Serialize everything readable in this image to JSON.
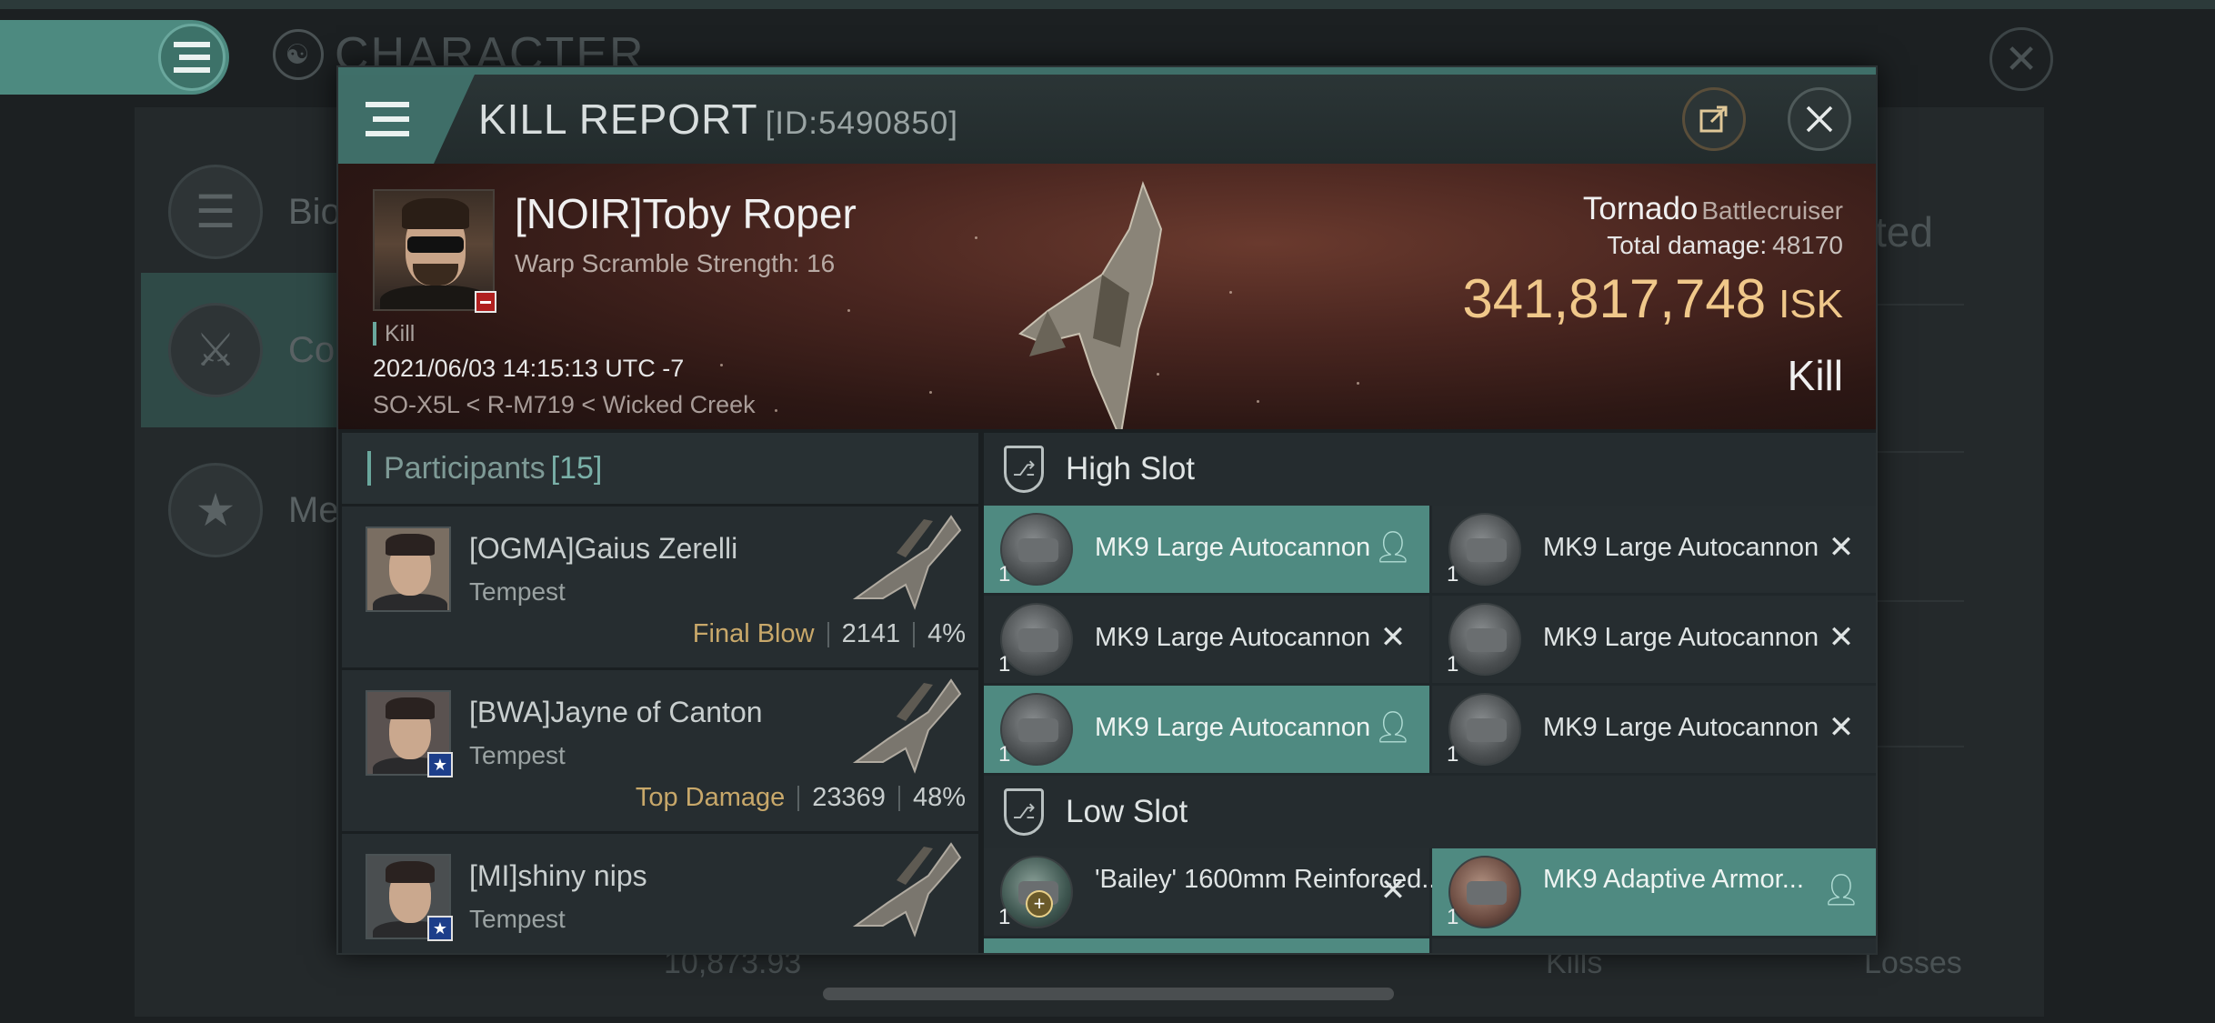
{
  "background": {
    "title": "CHARACTER",
    "side_items": [
      {
        "label": "Bio",
        "icon": "list-icon"
      },
      {
        "label": "Co",
        "icon": "crossed-swords-icon"
      },
      {
        "label": "Me",
        "icon": "star-medal-icon"
      }
    ],
    "right_text": "ted",
    "bottom_value": "10,873.93",
    "bottom_kills": "Kills",
    "bottom_losses": "Losses"
  },
  "modal": {
    "title": "KILL REPORT",
    "id": "[ID:5490850]",
    "share_icon": "share-icon",
    "close_icon": "close-icon"
  },
  "victim": {
    "name": "[NOIR]Toby Roper",
    "subtitle": "Warp Scramble Strength: 16",
    "kill_tag": "Kill",
    "date": "2021/06/03 14:15:13 UTC -7",
    "location": "SO-X5L < R-M719 < Wicked Creek",
    "ship": "Tornado",
    "ship_class": "Battlecruiser",
    "total_damage_label": "Total damage:",
    "total_damage": "48170",
    "isk_value": "341,817,748",
    "isk_unit": "ISK",
    "result": "Kill"
  },
  "participants": {
    "label": "Participants",
    "count": "[15]",
    "rows": [
      {
        "name": "[OGMA]Gaius Zerelli",
        "ship": "Tempest",
        "tag": "Final Blow",
        "damage": "2141",
        "percent": "4%",
        "star": false
      },
      {
        "name": "[BWA]Jayne of Canton",
        "ship": "Tempest",
        "tag": "Top Damage",
        "damage": "23369",
        "percent": "48%",
        "star": true
      },
      {
        "name": "[MI]shiny nips",
        "ship": "Tempest",
        "tag": "",
        "damage": "",
        "percent": "",
        "star": true
      }
    ]
  },
  "fitting": {
    "high_slot_label": "High Slot",
    "low_slot_label": "Low Slot",
    "high_slot": [
      {
        "name": "MK9 Large Autocannon",
        "qty": "1",
        "status": "person-icon",
        "highlight": true
      },
      {
        "name": "MK9 Large Autocannon",
        "qty": "1",
        "status": "x-icon",
        "highlight": false
      },
      {
        "name": "MK9 Large Autocannon",
        "qty": "1",
        "status": "x-icon",
        "highlight": false
      },
      {
        "name": "MK9 Large Autocannon",
        "qty": "1",
        "status": "x-icon",
        "highlight": false
      },
      {
        "name": "MK9 Large Autocannon",
        "qty": "1",
        "status": "person-icon",
        "highlight": true
      },
      {
        "name": "MK9 Large Autocannon",
        "qty": "1",
        "status": "x-icon",
        "highlight": false
      }
    ],
    "low_slot": [
      {
        "name": "'Bailey' 1600mm Reinforced...",
        "qty": "1",
        "status": "x-icon",
        "highlight": false
      },
      {
        "name": "MK9 Adaptive Armor...",
        "qty": "1",
        "status": "person-icon",
        "highlight": true
      }
    ]
  }
}
